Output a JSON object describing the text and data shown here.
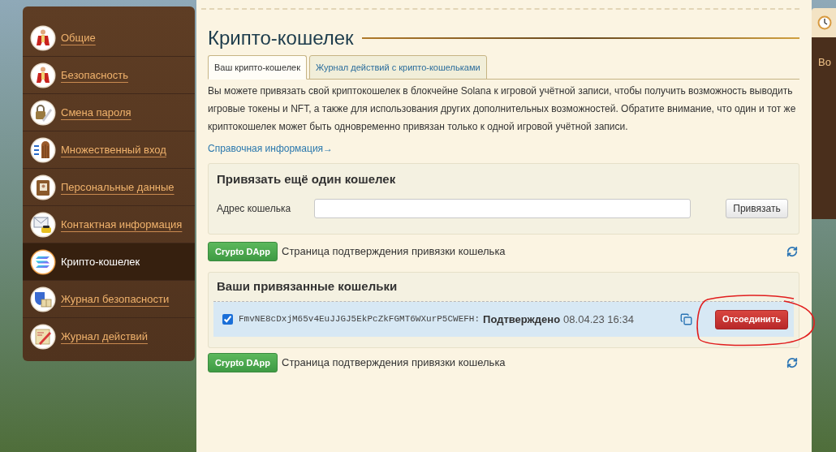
{
  "sidebar": {
    "items": [
      {
        "label": "Общие",
        "selected": false
      },
      {
        "label": "Безопасность",
        "selected": false
      },
      {
        "label": "Смена пароля",
        "selected": false
      },
      {
        "label": "Множественный вход",
        "selected": false
      },
      {
        "label": "Персональные данные",
        "selected": false
      },
      {
        "label": "Контактная информация",
        "selected": false
      },
      {
        "label": "Крипто-кошелек",
        "selected": true
      },
      {
        "label": "Журнал безопасности",
        "selected": false
      },
      {
        "label": "Журнал действий",
        "selected": false
      }
    ]
  },
  "page": {
    "title": "Крипто-кошелек"
  },
  "tabs": [
    {
      "label": "Ваш крипто-кошелек",
      "selected": true
    },
    {
      "label": "Журнал действий с крипто-кошельками",
      "selected": false
    }
  ],
  "intro": "Вы можете привязать свой криптокошелек в блокчейне Solana к игровой учётной записи, чтобы получить возможность выводить игровые токены и NFT, а также для использования других дополнительных возможностей. Обратите внимание, что один и тот же криптокошелек может быть одновременно привязан только к одной игровой учётной записи.",
  "help_link": "Справочная информация→",
  "add_wallet": {
    "title": "Привязать ещё один кошелек",
    "field_label": "Адрес кошелька",
    "button": "Привязать"
  },
  "dapp_bars": [
    {
      "button": "Crypto DApp",
      "text": "Страница подтверждения привязки кошелька"
    },
    {
      "button": "Crypto DApp",
      "text": "Страница подтверждения привязки кошелька"
    }
  ],
  "linked_wallets": {
    "title": "Ваши привязанные кошельки",
    "rows": [
      {
        "checked": true,
        "address": "FmvNE8cDxjM65v4EuJJGJ5EkPcZkFGMT6WXurP5CWEFH:",
        "status": "Подтверждено",
        "date": "08.04.23 16:34",
        "button": "Отсоединить"
      }
    ]
  },
  "right_panel": {
    "text": "Во"
  }
}
